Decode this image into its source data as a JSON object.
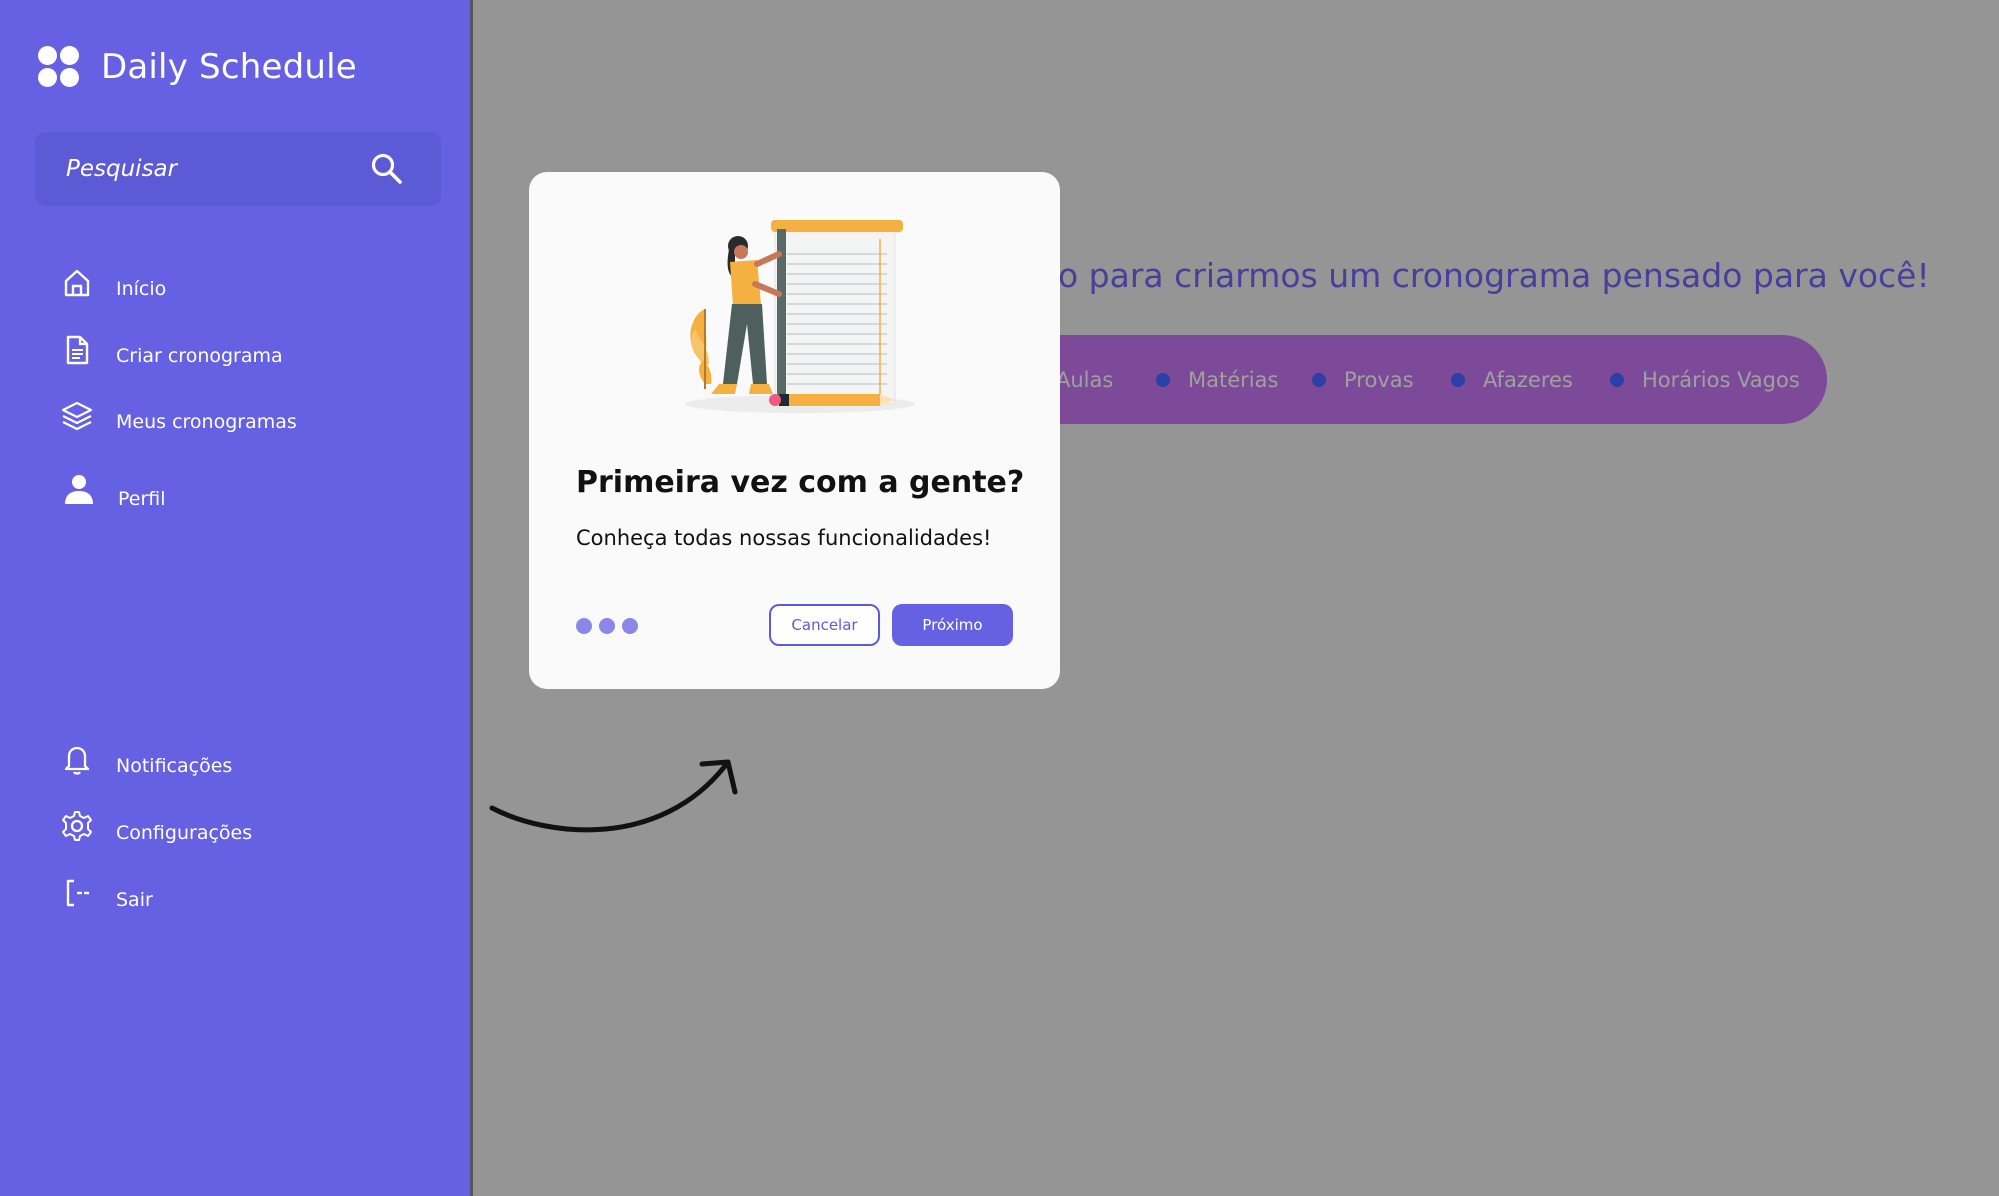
{
  "sidebar": {
    "brand": "Daily Schedule",
    "search_placeholder": "Pesquisar",
    "nav": [
      {
        "label": "Início",
        "icon": "home-icon"
      },
      {
        "label": "Criar cronograma",
        "icon": "document-icon"
      },
      {
        "label": "Meus cronogramas",
        "icon": "layers-icon"
      },
      {
        "label": "Perfil",
        "icon": "user-icon"
      }
    ],
    "bottom_nav": [
      {
        "label": "Notificações",
        "icon": "bell-icon"
      },
      {
        "label": "Configurações",
        "icon": "gear-icon"
      },
      {
        "label": "Sair",
        "icon": "logout-icon"
      }
    ]
  },
  "main": {
    "hero_text": "o para criarmos um cronograma pensado para você!",
    "categories": [
      "Aulas",
      "Matérias",
      "Provas",
      "Afazeres",
      "Horários Vagos"
    ]
  },
  "modal": {
    "title": "Primeira vez com a gente?",
    "subtitle": "Conheça todas nossas funcionalidades!",
    "steps": 3,
    "cancel_label": "Cancelar",
    "next_label": "Próximo"
  },
  "colors": {
    "sidebar": "#6661e3",
    "overlay": "#959595",
    "accent": "#5e5ae0",
    "pill": "#7d4a9a"
  }
}
